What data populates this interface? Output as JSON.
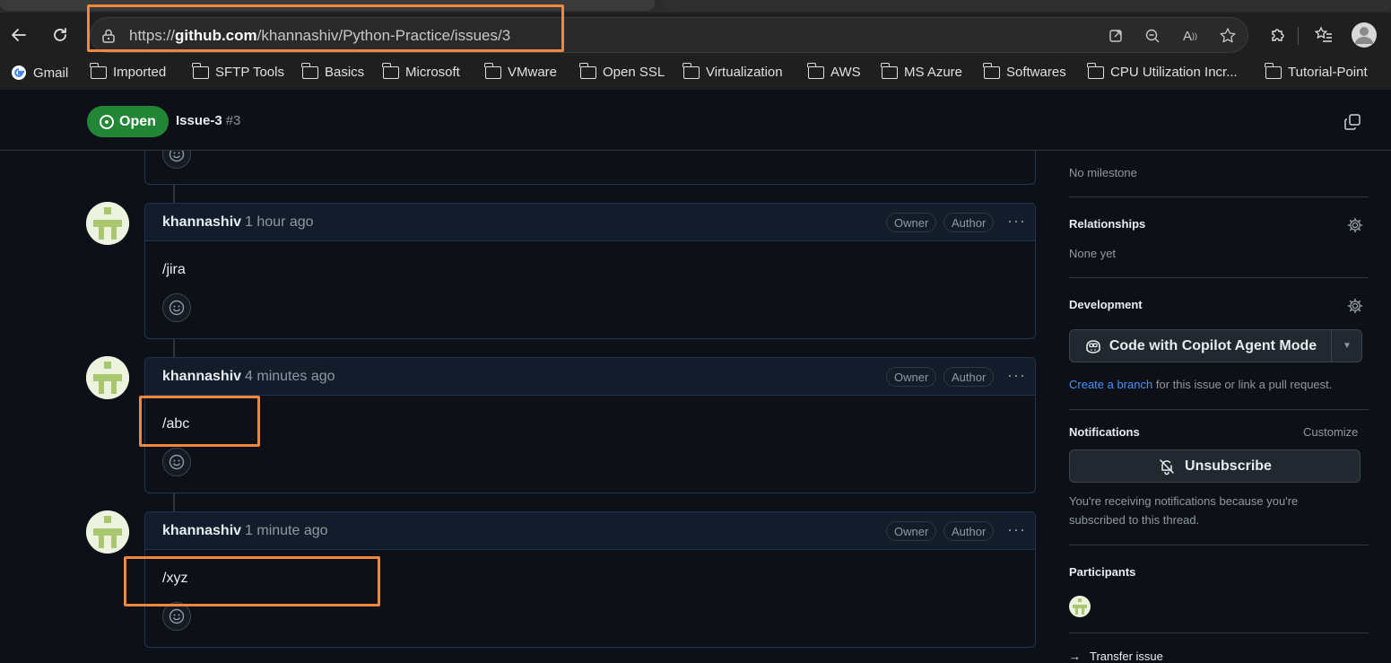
{
  "browser": {
    "url_prefix": "https://",
    "url_domain": "github.com",
    "url_path": "/khannashiv/Python-Practice/issues/3",
    "bookmarks": [
      {
        "label": "Gmail",
        "icon": "google-icon"
      },
      {
        "label": "Imported",
        "icon": "folder-icon"
      },
      {
        "label": "SFTP Tools",
        "icon": "folder-icon"
      },
      {
        "label": "Basics",
        "icon": "folder-icon"
      },
      {
        "label": "Microsoft",
        "icon": "folder-icon"
      },
      {
        "label": "VMware",
        "icon": "folder-icon"
      },
      {
        "label": "Open SSL",
        "icon": "folder-icon"
      },
      {
        "label": "Virtualization",
        "icon": "folder-icon"
      },
      {
        "label": "AWS",
        "icon": "folder-icon"
      },
      {
        "label": "MS Azure",
        "icon": "folder-icon"
      },
      {
        "label": "Softwares",
        "icon": "folder-icon"
      },
      {
        "label": "CPU Utilization Incr...",
        "icon": "folder-icon"
      },
      {
        "label": "Tutorial-Point",
        "icon": "folder-icon"
      }
    ]
  },
  "issue": {
    "state": "Open",
    "title": "Issue-3",
    "number": "#3"
  },
  "comments": [
    {
      "author": "khannashiv",
      "time": "1 hour ago",
      "badges": [
        "Owner",
        "Author"
      ],
      "body": "/jira"
    },
    {
      "author": "khannashiv",
      "time": "4 minutes ago",
      "badges": [
        "Owner",
        "Author"
      ],
      "body": "/abc"
    },
    {
      "author": "khannashiv",
      "time": "1 minute ago",
      "badges": [
        "Owner",
        "Author"
      ],
      "body": "/xyz"
    }
  ],
  "sidebar": {
    "milestone_text": "No milestone",
    "relationships_label": "Relationships",
    "relationships_text": "None yet",
    "development_label": "Development",
    "copilot_button": "Code with Copilot Agent Mode",
    "create_branch_link": "Create a branch",
    "create_branch_rest": " for this issue or link a pull request.",
    "notifications_label": "Notifications",
    "customize_label": "Customize",
    "unsubscribe_label": "Unsubscribe",
    "notifications_text_1": "You're receiving notifications because you're",
    "notifications_text_2": "subscribed to this thread.",
    "participants_label": "Participants",
    "transfer_label": "Transfer issue"
  },
  "colors": {
    "accent_highlight": "#f0883e",
    "open_green": "#238636",
    "link_blue": "#4493f8"
  }
}
